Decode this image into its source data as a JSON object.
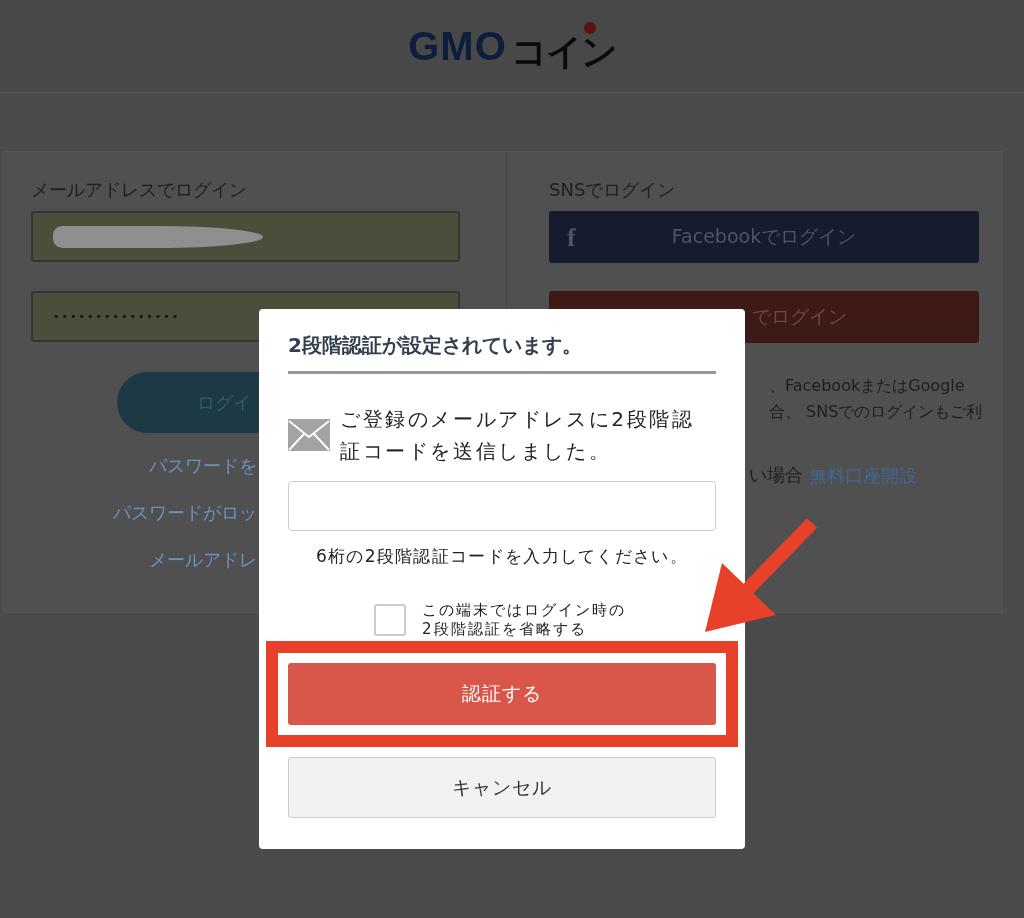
{
  "header": {
    "logo_latin": "GMO",
    "logo_kana": "コイン"
  },
  "email_login": {
    "heading": "メールアドレスでログイン",
    "email_field": {
      "redacted": true
    },
    "password_field": {
      "value": "•••••••••••••••"
    },
    "login_button": "ログイ",
    "links": [
      "パスワードを",
      "パスワードがロッ",
      "メールアドレ"
    ]
  },
  "sns_login": {
    "heading": "SNSでログイン",
    "buttons": [
      {
        "kind": "facebook",
        "icon": "f",
        "label": "Facebookでログイン"
      },
      {
        "kind": "google",
        "label": "でログイン"
      }
    ],
    "note_lines": [
      "、FacebookまたはGoogle",
      "合、 SNSでのログインもご利"
    ],
    "signup_text": "い場合",
    "signup_link": "無料口座開設"
  },
  "dialog": {
    "title": "2段階認証が設定されています。",
    "message": "ご登録のメールアドレスに2段階認証コードを送信しました。",
    "hint": "6桁の2段階認証コードを入力してください。",
    "remember": {
      "label": "この端末ではログイン時の2段階認証を省略する",
      "checked": false
    },
    "submit": "認証する",
    "submit_highlighted": true,
    "cancel": "キャンセル"
  }
}
